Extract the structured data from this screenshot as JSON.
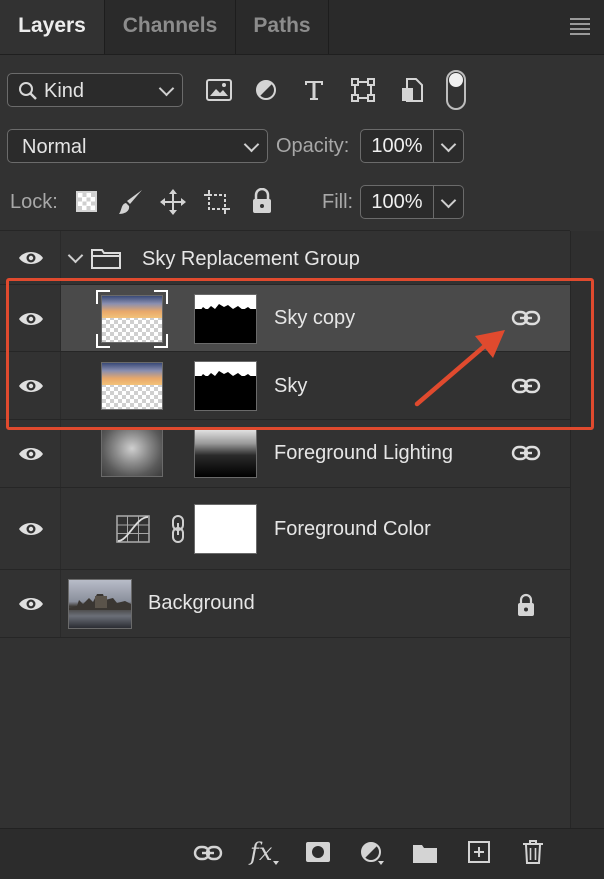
{
  "tabs": {
    "layers": "Layers",
    "channels": "Channels",
    "paths": "Paths"
  },
  "filter": {
    "kind_label": "Kind"
  },
  "blend": {
    "mode": "Normal",
    "opacity_label": "Opacity:",
    "opacity_value": "100%"
  },
  "lock": {
    "label": "Lock:",
    "fill_label": "Fill:",
    "fill_value": "100%"
  },
  "layers": {
    "group_name": "Sky Replacement Group",
    "sky_copy": "Sky copy",
    "sky": "Sky",
    "fg_lighting": "Foreground Lighting",
    "fg_color": "Foreground Color",
    "background": "Background"
  },
  "colors": {
    "panel_bg": "#323232",
    "highlight_row": "#4a4a4a",
    "annotation_red": "#e04a2e"
  },
  "icons": [
    "eye-icon",
    "folder-icon",
    "chain-link-icon",
    "lock-icon",
    "fx-icon",
    "mask-icon",
    "adjustment-icon",
    "new-layer-icon",
    "trash-icon"
  ],
  "footer": {
    "fx_label": "fx"
  }
}
